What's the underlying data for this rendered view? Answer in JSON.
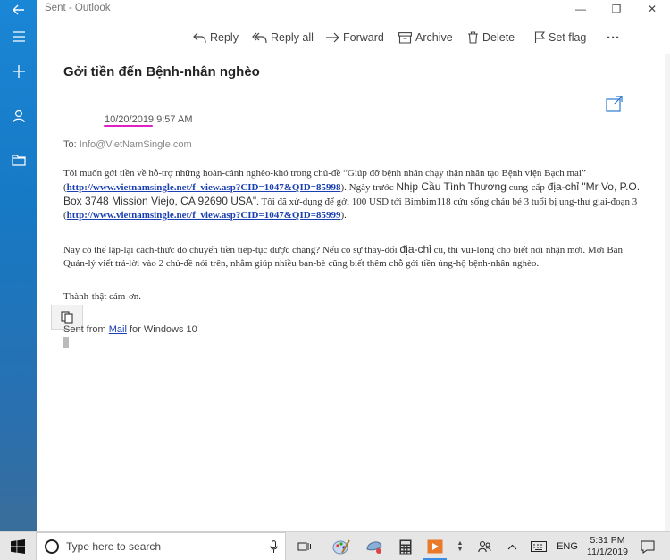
{
  "window": {
    "title": "Sent - Outlook",
    "controls": {
      "minimize": "—",
      "maximize": "❐",
      "close": "✕"
    }
  },
  "rail": {
    "icons": [
      "back-arrow-icon",
      "hamburger-menu-icon",
      "new-mail-plus-icon",
      "person-icon",
      "folder-icon"
    ]
  },
  "toolbar": {
    "reply": "Reply",
    "reply_all": "Reply all",
    "forward": "Forward",
    "archive": "Archive",
    "delete": "Delete",
    "set_flag": "Set flag",
    "more": "···"
  },
  "message": {
    "subject": "Gởi tiền đến Bệnh-nhân nghèo",
    "date": "10/20/2019",
    "time": "9:57 AM",
    "to_label": "To:",
    "to_address": "Info@VietNamSingle.com",
    "p1": {
      "t1": "Tôi muốn gởi tiền về hỗ-trợ những hoàn-cảnh nghèo-khó trong chủ-đề “Giúp đỡ bệnh nhân chạy thận nhân tạo Bệnh viện Bạch mai” (",
      "link1": "http://www.vietnamsingle.net/f_view.asp?CID=1047&QID=85998",
      "t2": "). Ngày trước ",
      "t3": "Nhịp Cầu Tình Thương",
      "t4": " cung-cấp ",
      "t5": "địa-chỉ \"Mr Vo, P.O. Box 3748 Mission Viejo, CA 92690 USA\"",
      "t6": ". Tôi đã xử-dụng để gởi 100 USD tới Bimbim118 cứu sống cháu bé 3 tuổi bị ung-thư giai-đoạn 3 (",
      "link2": "http://www.vietnamsingle.net/f_view.asp?CID=1047&QID=85999",
      "t7": ")."
    },
    "p2": {
      "t1": "Nay có thể lập-lại cách-thức đó chuyển tiền tiếp-tục được chăng? Nếu có sự thay-đổi ",
      "t2": "địa-chỉ",
      "t3": " cũ, thì vui-lòng cho biết nơi nhận mới. Mời Ban Quản-lý viết trả-lời vào 2 chủ-đề nói trên, nhằm giúp nhiều bạn-bè cũng biết thêm chỗ gởi tiền ủng-hộ bệnh-nhân nghèo."
    },
    "p3": "Thành-thật cám-ơn.",
    "signature": {
      "t1": "Sent from ",
      "link": "Mail",
      "t2": " for Windows 10"
    }
  },
  "taskbar": {
    "search_placeholder": "Type here to search",
    "language": "ENG",
    "time": "5:31 PM",
    "date": "11/1/2019"
  },
  "colors": {
    "rail_blue": "#1779c4",
    "link": "#1a3fb0",
    "date_underline": "#e020c8",
    "taskbar": "#e6e6e6"
  }
}
